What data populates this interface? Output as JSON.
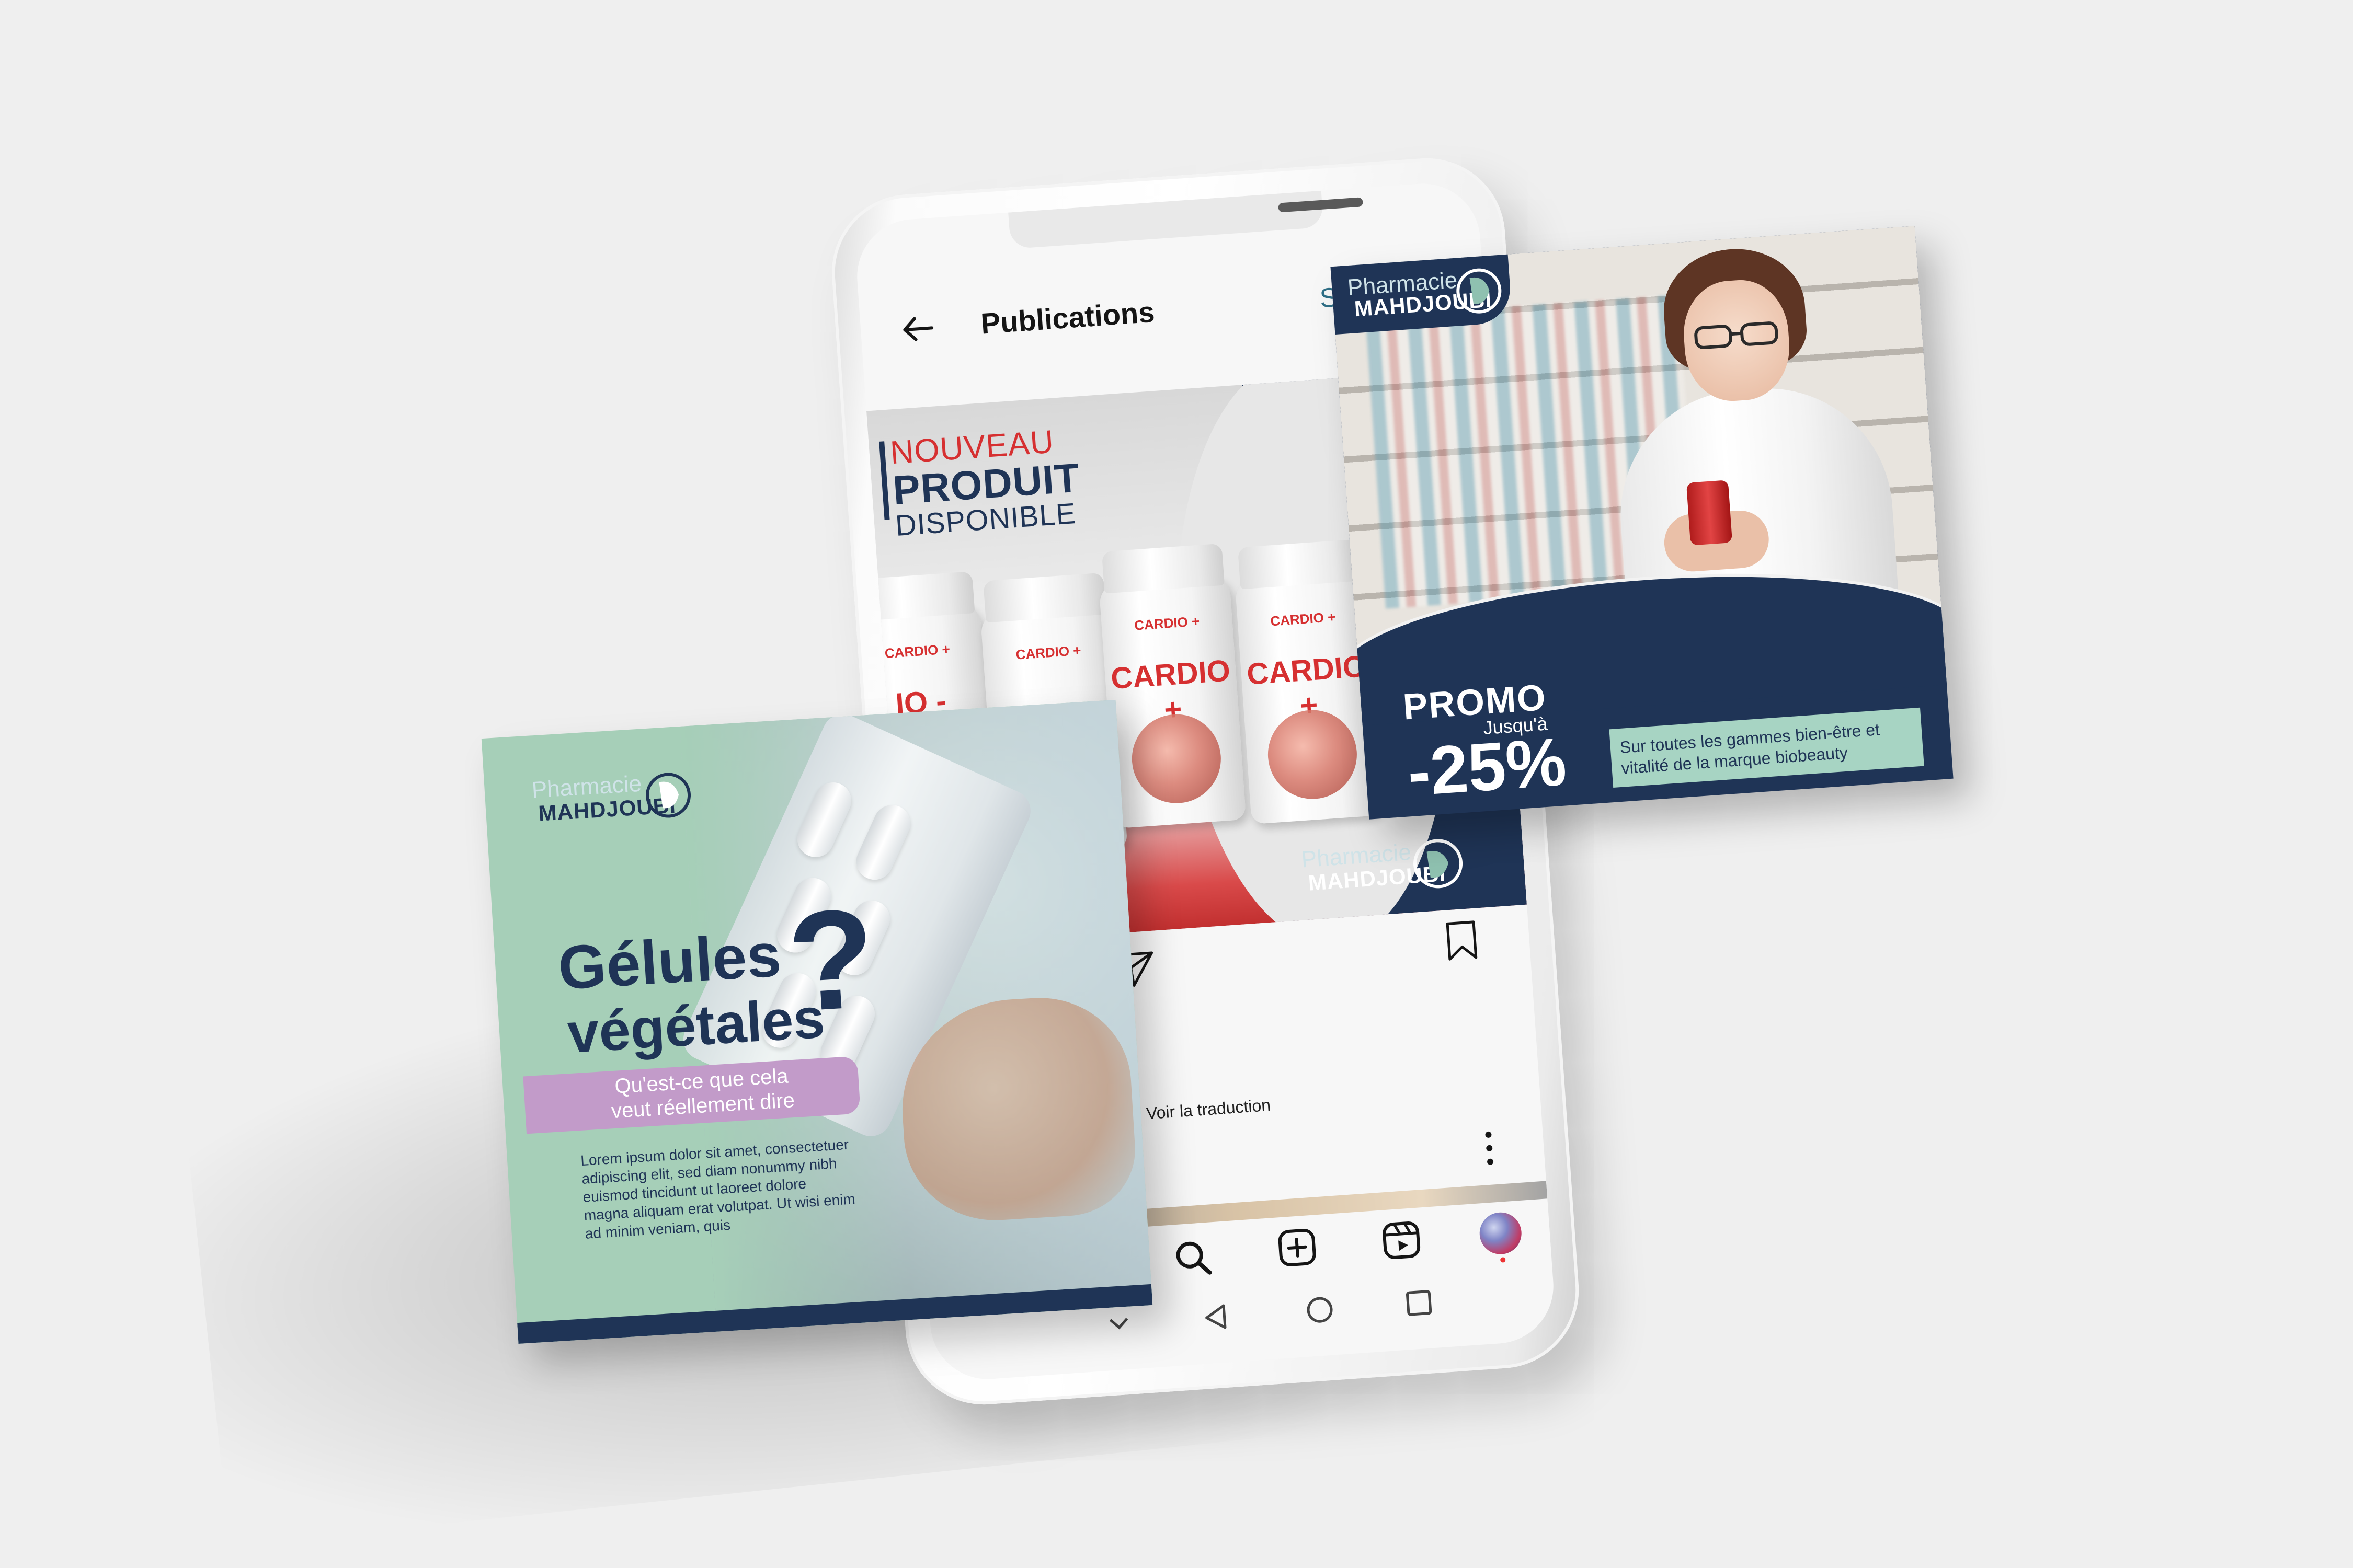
{
  "app": {
    "screen_title": "Publications",
    "follow_label": "Suivre",
    "translate_label": "Voir la traduction"
  },
  "post": {
    "headline_line1": "NOUVEAU",
    "headline_line2": "PRODUIT",
    "headline_line3": "DISPONIBLE",
    "product_small_label": "CARDIO +",
    "product_name": "CARDIO +",
    "product_partial": "IO -CARDIO +"
  },
  "brand": {
    "line1": "Pharmacie",
    "line2": "MAHDJOUBI"
  },
  "promo_card": {
    "word": "PROMO",
    "upto": "Jusqu'à",
    "discount": "-25%",
    "note": "Sur toutes les gammes bien-être et vitalité de la marque biobeauty"
  },
  "gelules_card": {
    "title_line1": "Gélules",
    "title_line2": "végétales",
    "question_mark": "?",
    "subtitle_line1": "Qu'est-ce que cela",
    "subtitle_line2": "veut réellement dire",
    "body": "Lorem ipsum dolor sit amet, consectetuer adipiscing elit, sed diam nonummy nibh euismod tincidunt ut laoreet dolore magna aliquam erat volutpat. Ut wisi enim ad minim veniam, quis"
  },
  "colors": {
    "navy": "#1f3456",
    "mint": "#a6cfb8",
    "lilac": "#c29bc9",
    "red": "#d63031",
    "link": "#2f6f86"
  },
  "icons": {
    "back": "arrow-left-icon",
    "send": "paper-plane-icon",
    "bookmark": "bookmark-icon",
    "more": "kebab-menu-icon",
    "search": "search-icon",
    "add": "plus-square-icon",
    "reels": "reels-icon",
    "profile": "avatar",
    "nav_down": "chevron-down-icon",
    "nav_back": "triangle-back-icon",
    "nav_home": "circle-home-icon",
    "nav_recent": "square-recent-icon"
  }
}
